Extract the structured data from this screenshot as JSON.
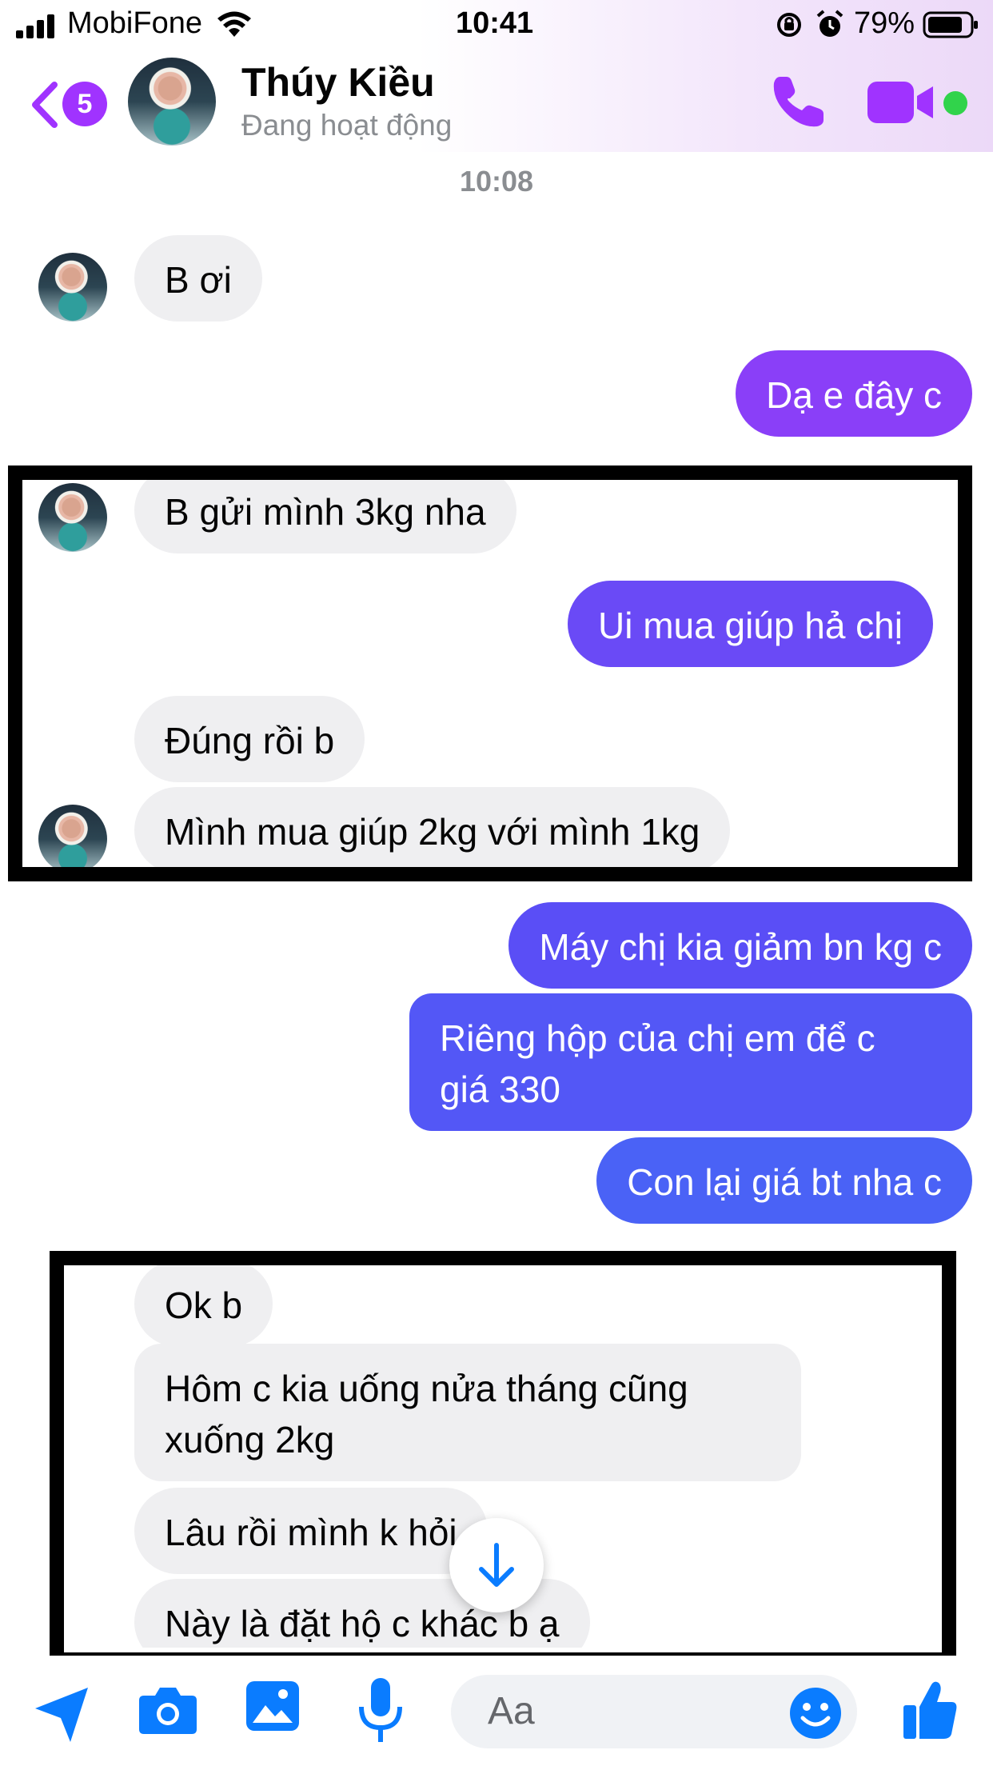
{
  "status_bar": {
    "carrier": "MobiFone",
    "time": "10:41",
    "battery": "79%"
  },
  "header": {
    "back_count": "5",
    "contact_name": "Thúy Kiều",
    "contact_status": "Đang hoạt động"
  },
  "conversation": {
    "timestamp": "10:08",
    "messages": [
      {
        "dir": "in",
        "text": "B ơi"
      },
      {
        "dir": "out",
        "text": "Dạ e đây c"
      },
      {
        "dir": "in",
        "text": "B gửi mình 3kg nha"
      },
      {
        "dir": "out",
        "text": "Ui mua giúp hả chị"
      },
      {
        "dir": "in",
        "text": "Đúng rồi b"
      },
      {
        "dir": "in",
        "text": "Mình mua giúp 2kg với mình 1kg"
      },
      {
        "dir": "out",
        "text": "Máy chị kia giảm bn kg c"
      },
      {
        "dir": "out",
        "line1": "Riêng hộp của chị em để c",
        "line2": "giá 330"
      },
      {
        "dir": "out",
        "text": "Con lại giá bt nha c"
      },
      {
        "dir": "in",
        "text": "Ok b"
      },
      {
        "dir": "in",
        "line1": "Hôm c kia uống nửa tháng cũng",
        "line2": "xuống 2kg"
      },
      {
        "dir": "in",
        "text": "Lâu rồi mình k hỏi"
      },
      {
        "dir": "in",
        "text": "Này là đặt hộ c khác b ạ"
      }
    ]
  },
  "composer": {
    "placeholder": "Aa"
  },
  "colors": {
    "accent": "#a033ff",
    "bubble_out_top": "#5b4cf5",
    "bubble_out_bottom": "#4a62f6",
    "bubble_in": "#efeff1",
    "icon_blue": "#0a7cff",
    "online": "#31d34b"
  }
}
